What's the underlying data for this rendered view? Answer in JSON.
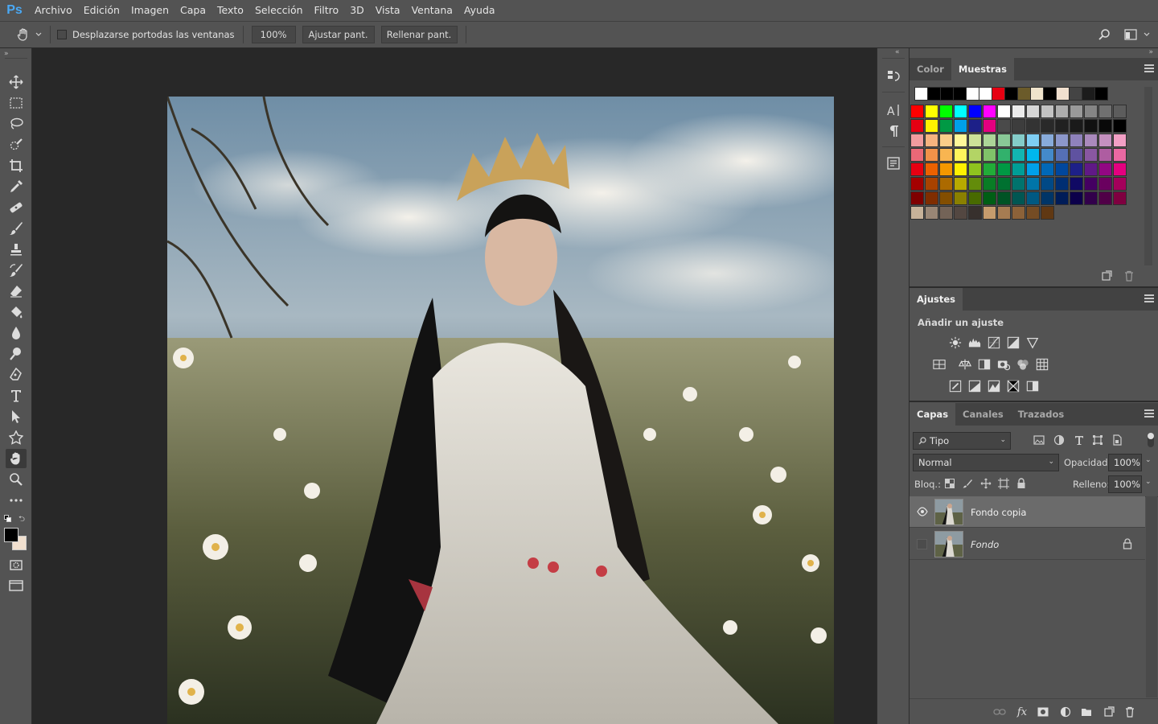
{
  "app": {
    "logo": "Ps"
  },
  "menu": [
    "Archivo",
    "Edición",
    "Imagen",
    "Capa",
    "Texto",
    "Selección",
    "Filtro",
    "3D",
    "Vista",
    "Ventana",
    "Ayuda"
  ],
  "options": {
    "scroll_all_label": "Desplazarse portodas las ventanas",
    "zoom_value": "100%",
    "fit_screen": "Ajustar pant.",
    "fill_screen": "Rellenar pant."
  },
  "tools": [
    "move-tool",
    "marquee-tool",
    "lasso-tool",
    "quick-select-tool",
    "crop-tool",
    "eyedropper-tool",
    "healing-brush-tool",
    "brush-tool",
    "clone-stamp-tool",
    "history-brush-tool",
    "eraser-tool",
    "paint-bucket-tool",
    "blur-tool",
    "dodge-tool",
    "pen-tool",
    "type-tool",
    "path-select-tool",
    "shape-tool",
    "hand-tool",
    "zoom-tool",
    "more-tools"
  ],
  "active_tool": "hand-tool",
  "swatches_panel": {
    "tabs": [
      "Color",
      "Muestras"
    ],
    "active_tab": "Muestras",
    "recent": [
      "#ffffff",
      "#000000",
      "#000000",
      "#000000",
      "#ffffff",
      "#ffffff",
      "#e60012",
      "#000000",
      "#6b5b2a",
      "#efe3cc",
      "#000000",
      "#f1e0cf",
      "#444444",
      "#1c1c1c",
      "#000000"
    ],
    "rows": [
      [
        "#ff0000",
        "#ffff00",
        "#00ff00",
        "#00ffff",
        "#0000ff",
        "#ff00ff",
        "#ffffff",
        "#ebebeb",
        "#d6d6d6",
        "#c2c2c2",
        "#adadad",
        "#999999",
        "#858585",
        "#707070",
        "#5c5c5c"
      ],
      [
        "#e60012",
        "#fff100",
        "#009944",
        "#00a0e9",
        "#1d2088",
        "#e4007f",
        "#4a4a4a",
        "#3d3d3d",
        "#333333",
        "#292929",
        "#212121",
        "#1a1a1a",
        "#111111",
        "#090909",
        "#000000"
      ],
      [
        "#f29c9f",
        "#f6b37f",
        "#facd89",
        "#fff799",
        "#cce198",
        "#acd598",
        "#89c997",
        "#84ccc9",
        "#7ecef4",
        "#88abda",
        "#8c97cb",
        "#8f82bc",
        "#aa89bd",
        "#c490bf",
        "#f29fc5"
      ],
      [
        "#eb6877",
        "#f19149",
        "#f8b551",
        "#fff45c",
        "#b3d465",
        "#80c269",
        "#32b16c",
        "#13b5b1",
        "#00b7ee",
        "#448aca",
        "#556fb5",
        "#5f52a0",
        "#8957a1",
        "#ae5da1",
        "#ea68a2"
      ],
      [
        "#e60012",
        "#eb6100",
        "#f39800",
        "#fff100",
        "#8fc31f",
        "#22ac38",
        "#009944",
        "#009e96",
        "#00a0e9",
        "#0068b7",
        "#00479d",
        "#1d2088",
        "#601986",
        "#920783",
        "#e4007f"
      ],
      [
        "#a40000",
        "#a84200",
        "#ac6a00",
        "#b7aa00",
        "#638c0b",
        "#097c25",
        "#007130",
        "#00736d",
        "#0075a9",
        "#004986",
        "#002e73",
        "#100964",
        "#440062",
        "#6a005f",
        "#a4005b"
      ],
      [
        "#7f0000",
        "#7f2d00",
        "#834e00",
        "#8a8000",
        "#486a00",
        "#005e15",
        "#005325",
        "#005652",
        "#005982",
        "#003567",
        "#001c58",
        "#0c004a",
        "#32004b",
        "#500047",
        "#7f0040"
      ],
      [
        "#c7b299",
        "#998675",
        "#736357",
        "#534741",
        "#37302d",
        "#c69c6d",
        "#a67c52",
        "#8c6239",
        "#754c24",
        "#603813"
      ]
    ]
  },
  "adjustments_panel": {
    "tab": "Ajustes",
    "heading": "Añadir un ajuste"
  },
  "layers_panel": {
    "tabs": [
      "Capas",
      "Canales",
      "Trazados"
    ],
    "active_tab": "Capas",
    "filter_kind": "Tipo",
    "blend_mode": "Normal",
    "opacity_label": "Opacidad:",
    "opacity_value": "100%",
    "lock_label": "Bloq.:",
    "fill_label": "Relleno:",
    "fill_value": "100%",
    "layers": [
      {
        "name": "Fondo copia",
        "visible": true,
        "selected": true,
        "locked": false
      },
      {
        "name": "Fondo",
        "visible": false,
        "selected": false,
        "locked": true
      }
    ]
  }
}
